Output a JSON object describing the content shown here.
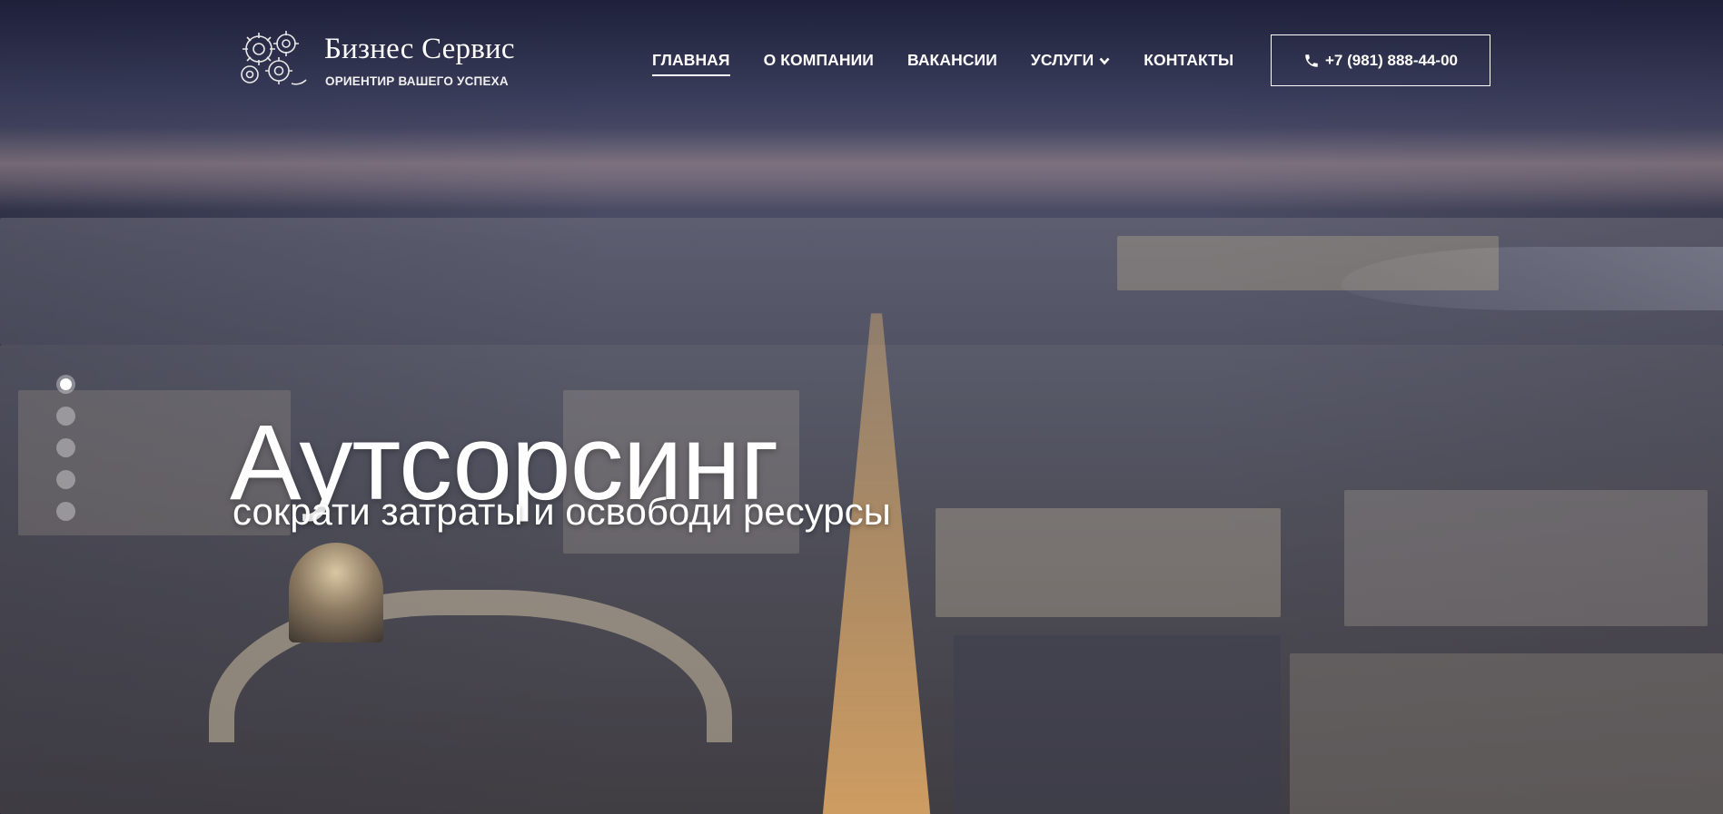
{
  "brand": {
    "name": "Бизнес Сервис",
    "tagline": "ОРИЕНТИР ВАШЕГО УСПЕХА"
  },
  "nav": {
    "items": [
      {
        "label": "ГЛАВНАЯ",
        "active": true
      },
      {
        "label": "О КОМПАНИИ",
        "active": false
      },
      {
        "label": "ВАКАНСИИ",
        "active": false
      },
      {
        "label": "УСЛУГИ",
        "active": false,
        "dropdown": true
      },
      {
        "label": "КОНТАКТЫ",
        "active": false
      }
    ]
  },
  "phone": {
    "label": "+7 (981) 888-44-00",
    "icon": "phone-icon"
  },
  "hero": {
    "title": "Аутсорсинг",
    "subtitle": "сократи затраты и освободи ресурсы",
    "slide_count": 5,
    "active_slide": 1
  },
  "colors": {
    "text": "#ffffff",
    "overlay": "#2c3350"
  }
}
